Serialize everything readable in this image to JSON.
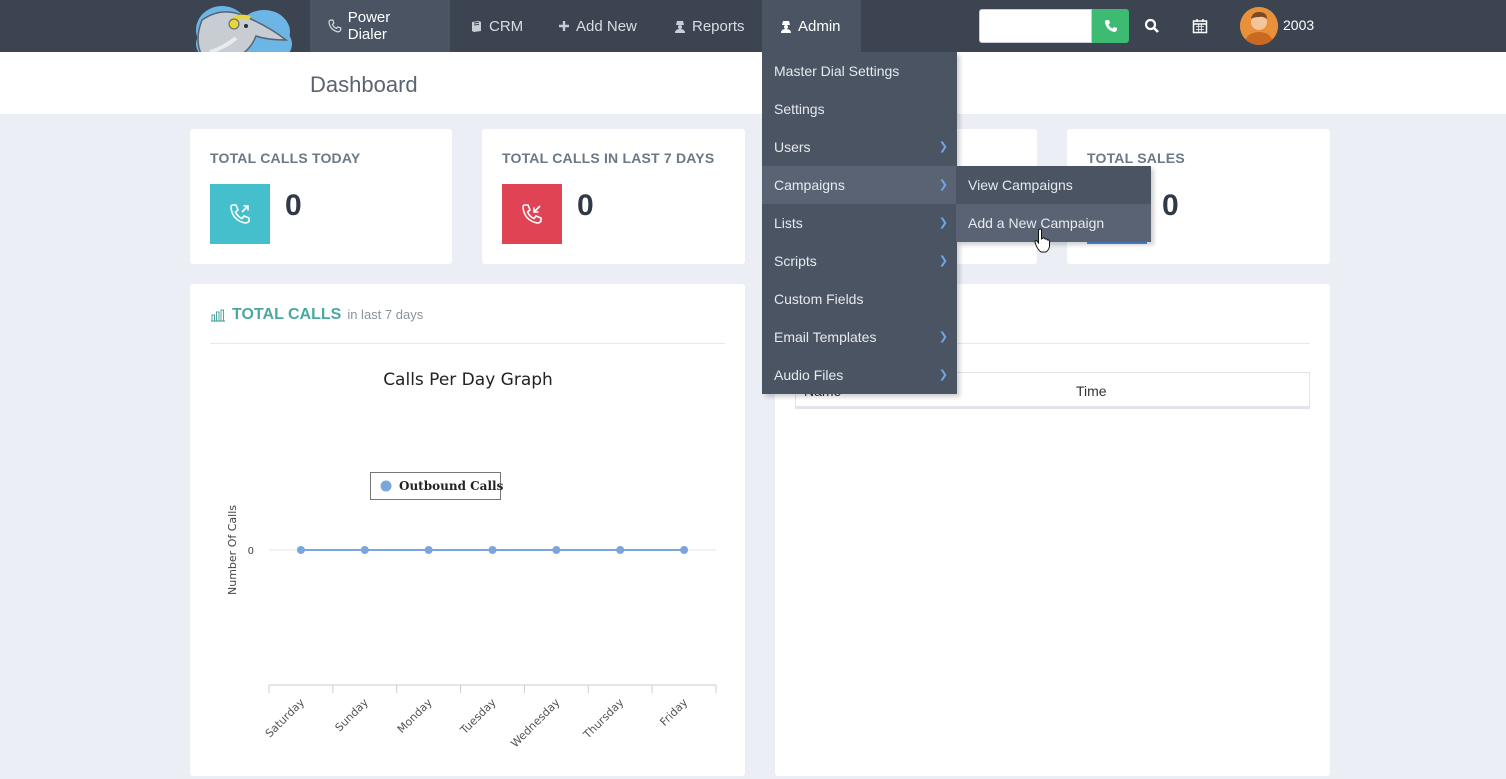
{
  "nav": {
    "items": [
      {
        "label": "Power Dialer",
        "icon": "phone-handset-icon"
      },
      {
        "label": "CRM",
        "icon": "book-icon"
      },
      {
        "label": "Add New",
        "icon": "plus-icon"
      },
      {
        "label": "Reports",
        "icon": "user-secret-icon"
      },
      {
        "label": "Admin",
        "icon": "user-secret-icon"
      }
    ],
    "user_number": "2003"
  },
  "header": {
    "title": "Dashboard"
  },
  "stats": [
    {
      "title": "TOTAL CALLS TODAY",
      "value": "0",
      "color": "#45bfcc",
      "icon": "outgoing-call-icon"
    },
    {
      "title": "TOTAL CALLS IN LAST 7 DAYS",
      "value": "0",
      "color": "#e04454",
      "icon": "incoming-call-icon"
    },
    {
      "title": "TOTAL SALES",
      "value": "0",
      "color": "#4a8fd8",
      "icon": "sales-icon"
    }
  ],
  "chart_panel": {
    "title": "TOTAL CALLS",
    "subtitle": "in last 7 days"
  },
  "chart_data": {
    "type": "line",
    "title": "Calls Per Day Graph",
    "categories": [
      "Saturday",
      "Sunday",
      "Monday",
      "Tuesday",
      "Wednesday",
      "Thursday",
      "Friday"
    ],
    "series": [
      {
        "name": "Outbound Calls",
        "values": [
          0,
          0,
          0,
          0,
          0,
          0,
          0
        ],
        "color": "#7aa6e0"
      }
    ],
    "xlabel": "",
    "ylabel": "Number Of Calls",
    "yticks": [
      "0"
    ],
    "legend": "top-center"
  },
  "table": {
    "columns": [
      "Name",
      "Time"
    ]
  },
  "admin_menu": {
    "items": [
      {
        "label": "Master Dial Settings",
        "submenu": false
      },
      {
        "label": "Settings",
        "submenu": false
      },
      {
        "label": "Users",
        "submenu": true
      },
      {
        "label": "Campaigns",
        "submenu": true
      },
      {
        "label": "Lists",
        "submenu": true
      },
      {
        "label": "Scripts",
        "submenu": true
      },
      {
        "label": "Custom Fields",
        "submenu": false
      },
      {
        "label": "Email Templates",
        "submenu": true
      },
      {
        "label": "Audio Files",
        "submenu": true
      }
    ],
    "campaigns_submenu": [
      "View Campaigns",
      "Add a New Campaign"
    ]
  }
}
